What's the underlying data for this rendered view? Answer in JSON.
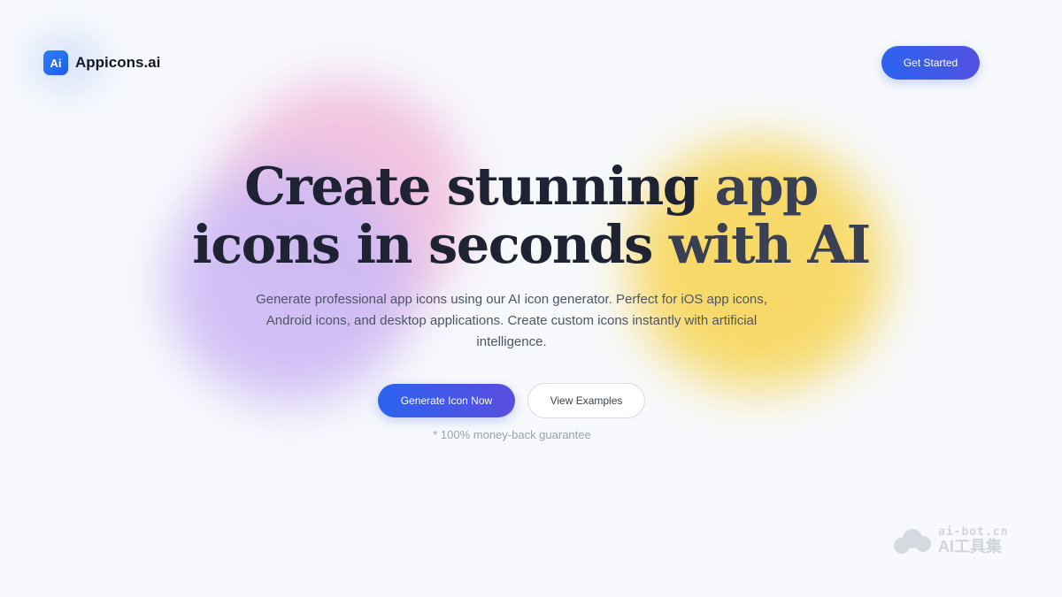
{
  "header": {
    "brand_mark": "Ai",
    "brand_name": "Appicons.ai",
    "cta_label": "Get Started"
  },
  "hero": {
    "title_line1_part1": "Create stunning ",
    "title_line1_part2": "app",
    "title_line2_part1": "icons in seconds ",
    "title_line2_part2": "with AI",
    "subtitle": "Generate professional app icons using our AI icon generator. Perfect for iOS app icons, Android icons, and desktop applications. Create custom icons instantly with artificial intelligence.",
    "primary_button": "Generate Icon Now",
    "secondary_button": "View Examples",
    "guarantee": "* 100% money-back guarantee"
  },
  "watermark": {
    "line1": "ai-bot.cn",
    "line2": "AI工具集"
  },
  "colors": {
    "accent": "#2c63ef",
    "background": "#f7f9fc",
    "blob_pink": "#f2c1df",
    "blob_purple": "#cdbaf5",
    "blob_yellow": "#f7d862"
  }
}
